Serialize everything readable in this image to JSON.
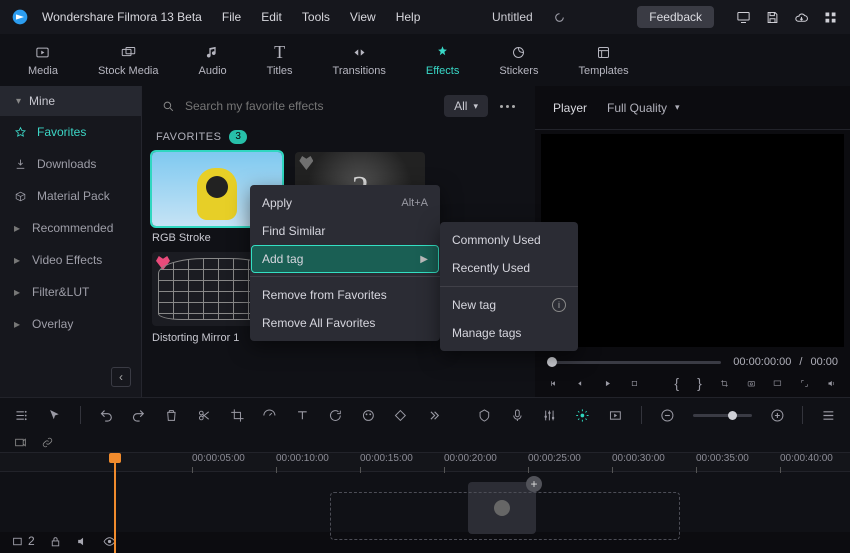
{
  "titlebar": {
    "app": "Wondershare Filmora 13 Beta",
    "menu": [
      "File",
      "Edit",
      "Tools",
      "View",
      "Help"
    ],
    "doc": "Untitled",
    "feedback": "Feedback"
  },
  "tabs": [
    {
      "id": "media",
      "label": "Media"
    },
    {
      "id": "stock",
      "label": "Stock Media"
    },
    {
      "id": "audio",
      "label": "Audio"
    },
    {
      "id": "titles",
      "label": "Titles"
    },
    {
      "id": "transitions",
      "label": "Transitions"
    },
    {
      "id": "effects",
      "label": "Effects"
    },
    {
      "id": "stickers",
      "label": "Stickers"
    },
    {
      "id": "templates",
      "label": "Templates"
    }
  ],
  "active_tab": "effects",
  "sidebar": {
    "header": "Mine",
    "items": [
      {
        "label": "Favorites",
        "active": true,
        "icon": "star"
      },
      {
        "label": "Downloads",
        "active": false,
        "icon": "download"
      },
      {
        "label": "Material Pack",
        "active": false,
        "icon": "package"
      },
      {
        "label": "Recommended",
        "active": false,
        "caret": true
      },
      {
        "label": "Video Effects",
        "active": false,
        "caret": true
      },
      {
        "label": "Filter&LUT",
        "active": false,
        "caret": true
      },
      {
        "label": "Overlay",
        "active": false,
        "caret": true
      }
    ]
  },
  "browser": {
    "search_placeholder": "Search my favorite effects",
    "filter": "All",
    "section_title": "FAVORITES",
    "section_count": "3",
    "thumbs": [
      {
        "label": "RGB Stroke",
        "selected": true,
        "heart": false,
        "kind": "rgb"
      },
      {
        "label": "",
        "selected": false,
        "heart": true,
        "kind": "countdown"
      },
      {
        "label": "Distorting Mirror 1",
        "selected": false,
        "heart": true,
        "kind": "mirror"
      }
    ]
  },
  "context_menu": {
    "items": [
      {
        "label": "Apply",
        "shortcut": "Alt+A"
      },
      {
        "label": "Find Similar"
      },
      {
        "label": "Add tag",
        "submenu": true,
        "highlight": true
      },
      {
        "sep": true
      },
      {
        "label": "Remove from Favorites"
      },
      {
        "label": "Remove All Favorites"
      }
    ],
    "submenu": [
      "Commonly Used",
      "Recently Used",
      "New tag",
      "Manage tags"
    ]
  },
  "player": {
    "title": "Player",
    "quality": "Full Quality",
    "time_current": "00:00:00:00",
    "time_total": "00:00"
  },
  "ruler": [
    "00:00:05:00",
    "00:00:10:00",
    "00:00:15:00",
    "00:00:20:00",
    "00:00:25:00",
    "00:00:30:00",
    "00:00:35:00",
    "00:00:40:00"
  ],
  "track_icons": {
    "row_index": "2"
  }
}
